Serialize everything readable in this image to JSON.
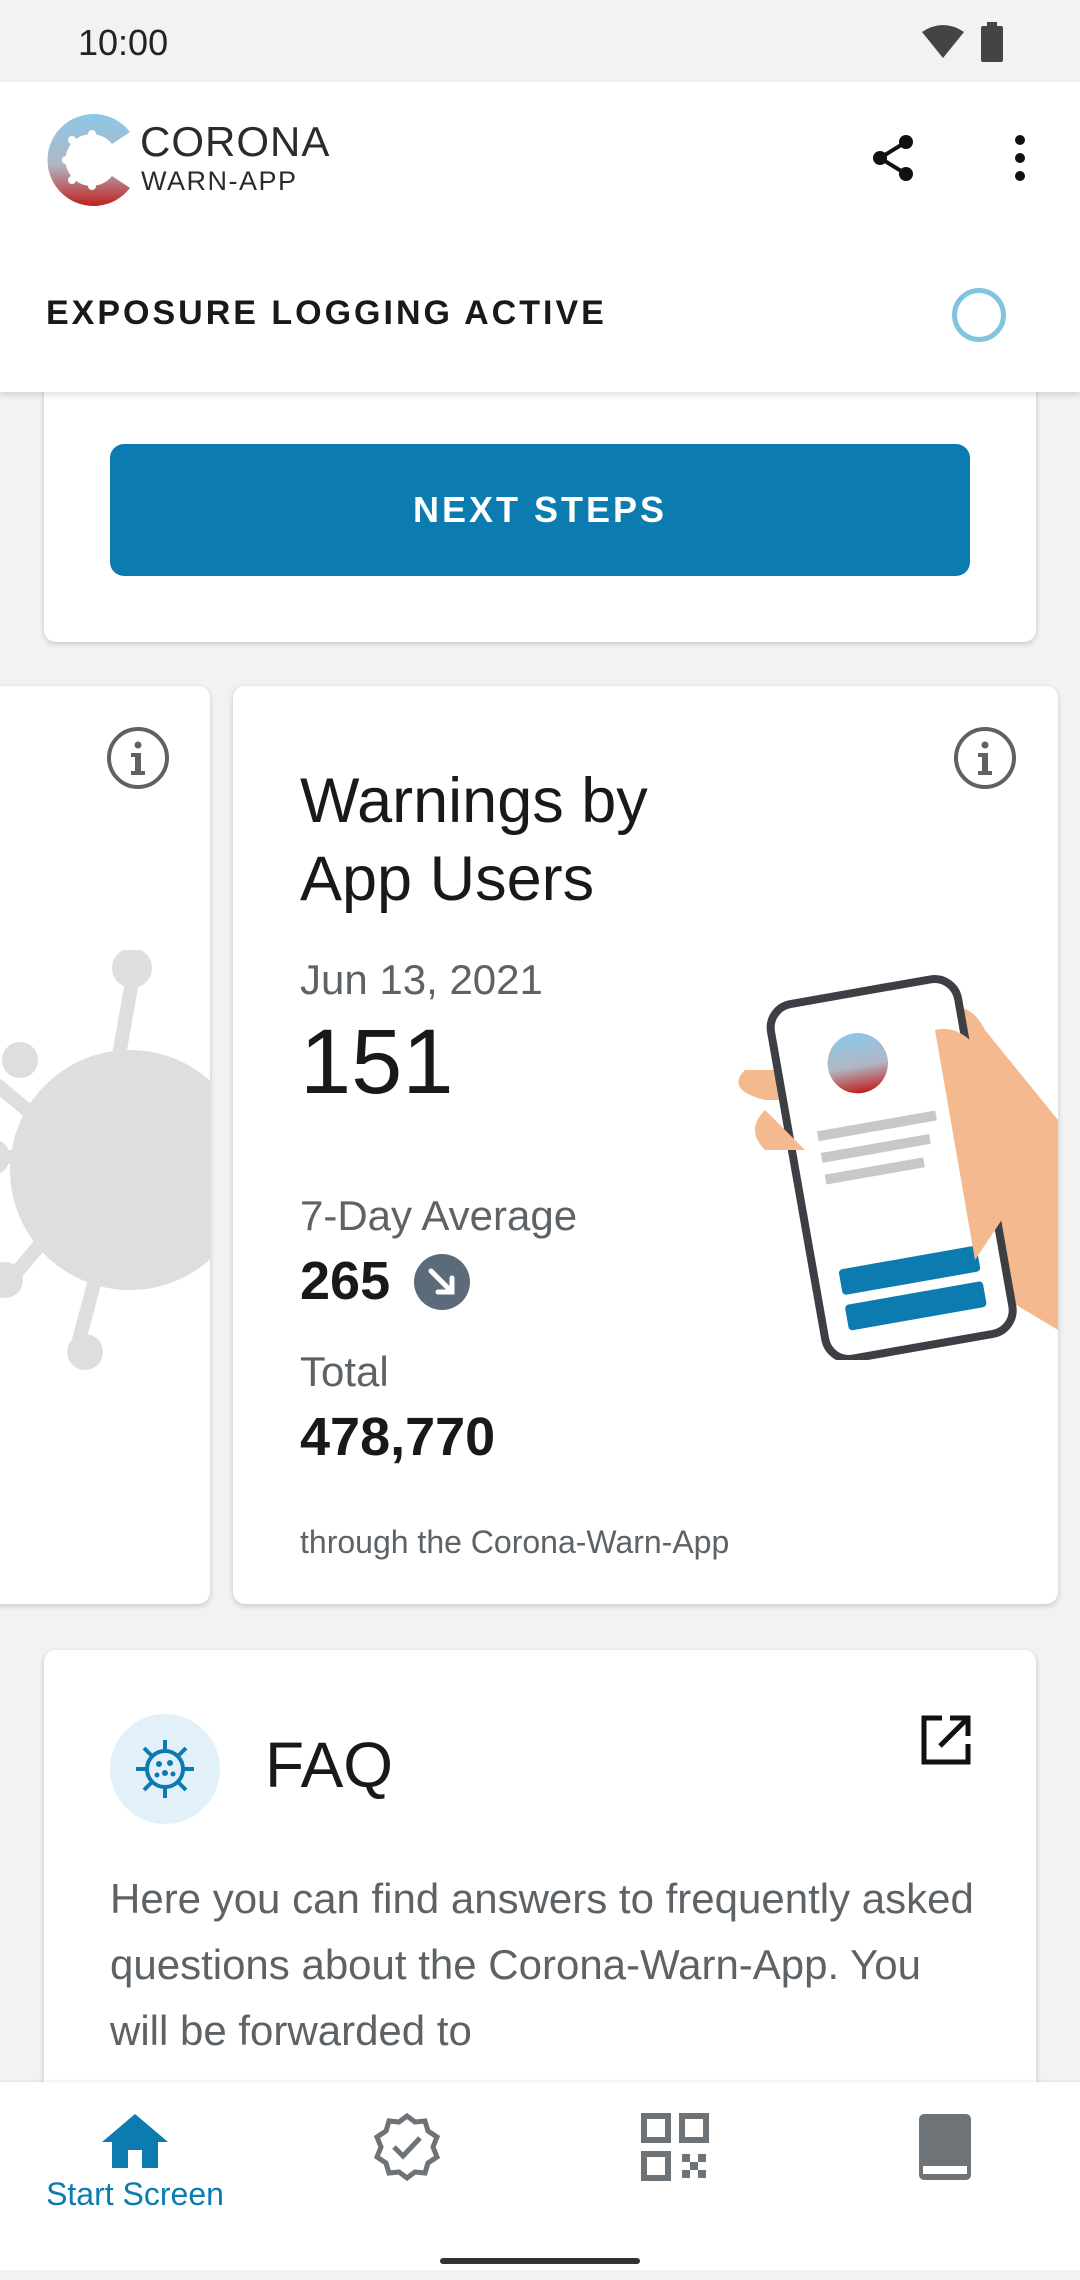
{
  "status_bar": {
    "time": "10:00"
  },
  "header": {
    "brand_title": "CORONA",
    "brand_subtitle": "WARN-APP",
    "exposure_label": "EXPOSURE LOGGING ACTIVE"
  },
  "top_card": {
    "button_label": "NEXT STEPS"
  },
  "warnings_card": {
    "title": "Warnings by App Users",
    "date": "Jun 13, 2021",
    "value": "151",
    "avg_label": "7-Day Average",
    "avg_value": "265",
    "total_label": "Total",
    "total_value": "478,770",
    "footnote": "through the Corona-Warn-App"
  },
  "faq_card": {
    "title": "FAQ",
    "text": "Here you can find answers to frequently asked questions about the Corona-Warn-App. You will be forwarded to"
  },
  "bottom_nav": {
    "items": [
      {
        "label": "Start Screen",
        "icon": "home-icon",
        "active": true
      },
      {
        "label": "",
        "icon": "certificate-icon"
      },
      {
        "label": "",
        "icon": "qr-code-icon"
      },
      {
        "label": "",
        "icon": "diary-icon"
      }
    ]
  },
  "colors": {
    "primary": "#0b7bb0",
    "ring": "#81c4de",
    "text_secondary": "#5d6266",
    "skin": "#f4b98e"
  }
}
